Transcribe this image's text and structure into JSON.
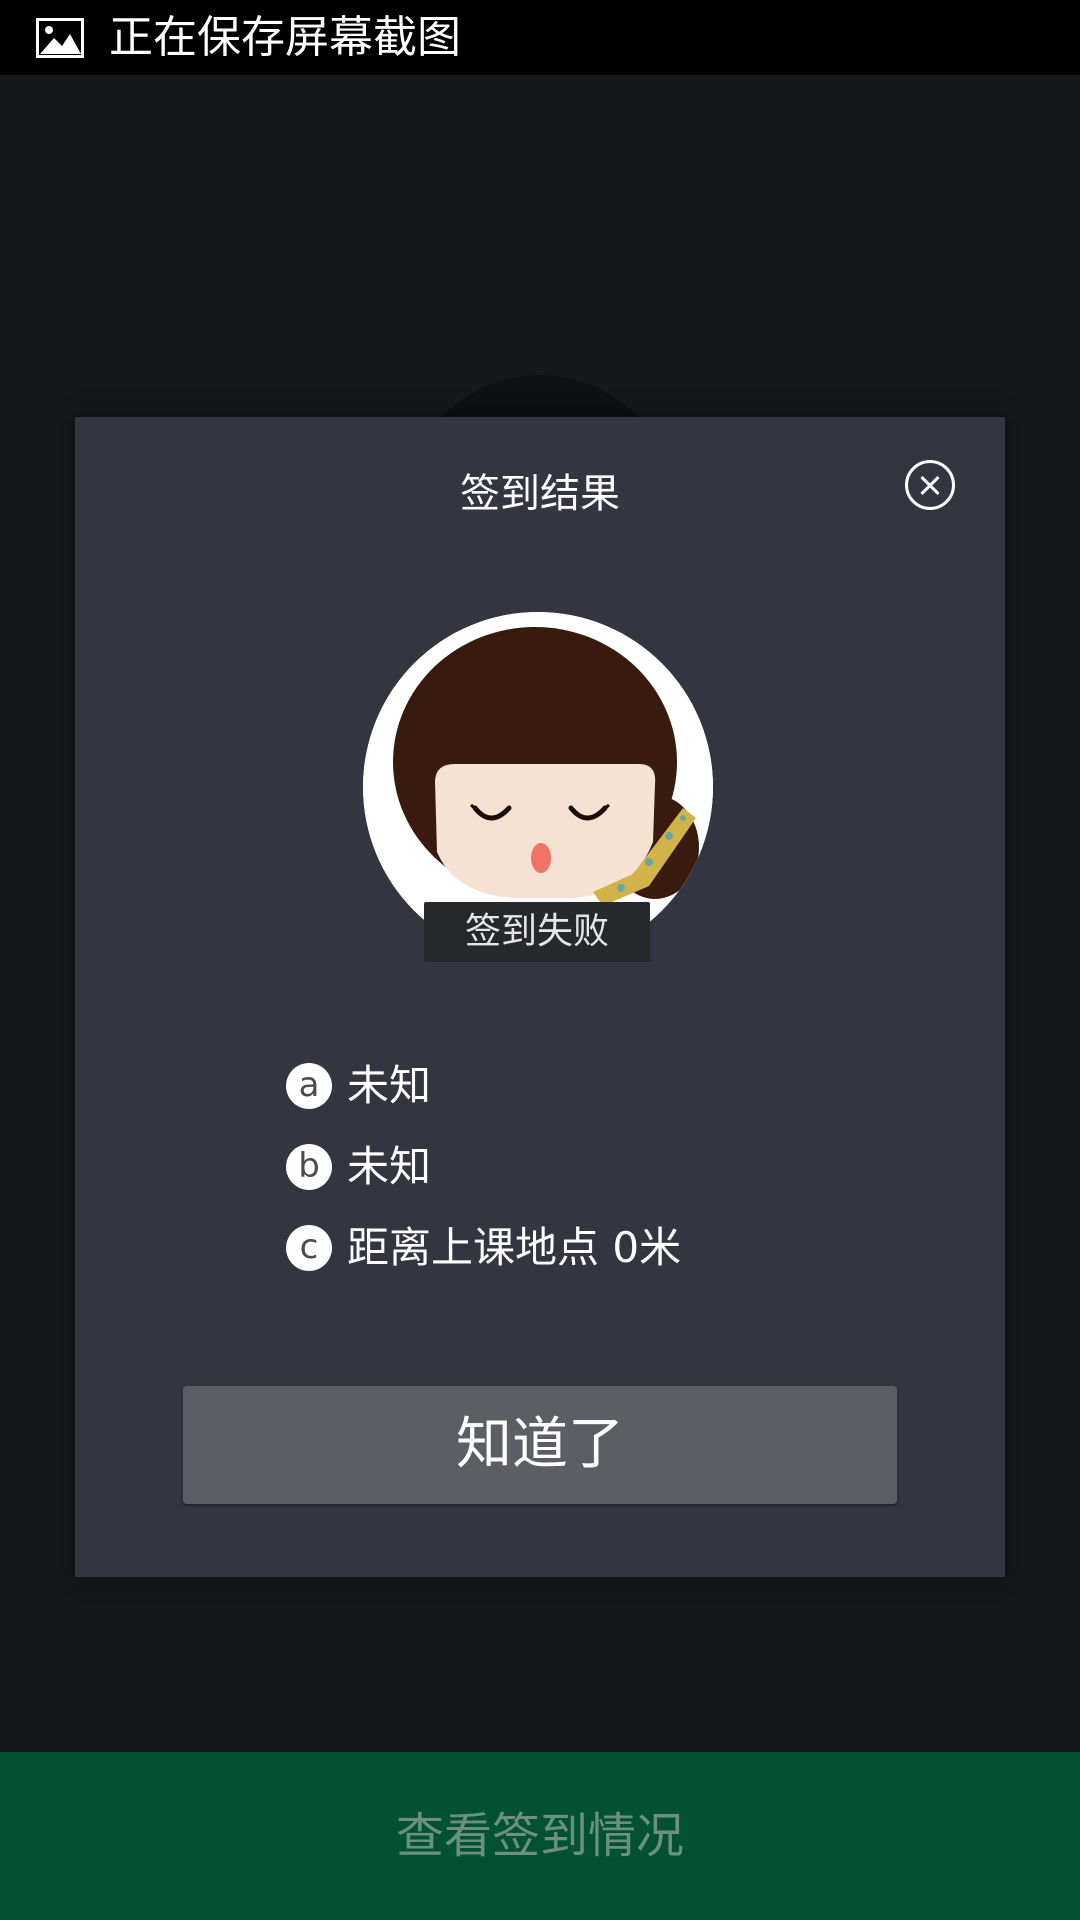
{
  "status_bar": {
    "icon": "image-icon",
    "text": "正在保存屏幕截图"
  },
  "dialog": {
    "title": "签到结果",
    "close_icon": "close-icon",
    "avatar_icon": "girl-avatar",
    "status_badge": "签到失败",
    "info_rows": [
      {
        "icon_letter": "a",
        "text": "未知"
      },
      {
        "icon_letter": "b",
        "text": "未知"
      },
      {
        "icon_letter": "c",
        "text": "距离上课地点 0米"
      }
    ],
    "confirm_label": "知道了"
  },
  "bottom_bar": {
    "label": "查看签到情况"
  },
  "colors": {
    "background": "#17181c",
    "dialog": "#333641",
    "button": "#5c5e66",
    "bottom_bar": "#005233",
    "bottom_bar_text": "#6c8f80"
  }
}
